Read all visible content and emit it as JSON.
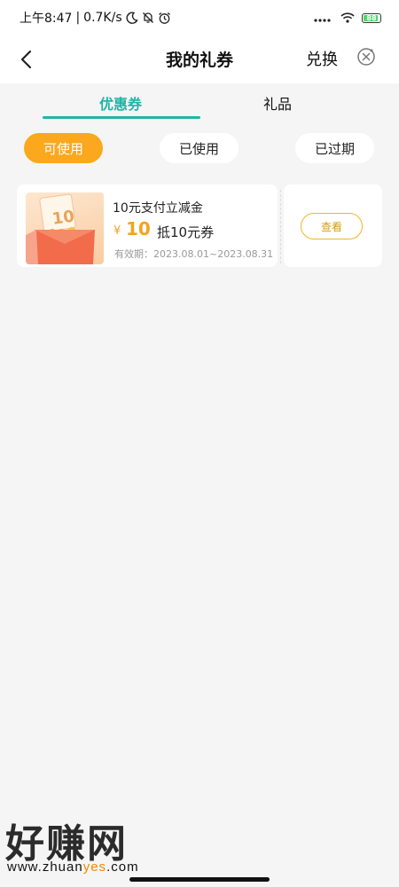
{
  "status_bar": {
    "time": "上午8:47",
    "separator": "|",
    "network_speed": "0.7K/s",
    "battery": "88",
    "icons": [
      "moon-icon",
      "bell-muted-icon",
      "alarm-icon",
      "signal-icon",
      "wifi-icon",
      "battery-icon"
    ]
  },
  "header": {
    "title": "我的礼券",
    "exchange_label": "兑换",
    "icons": [
      "back-arrow-icon",
      "close-circle-icon"
    ]
  },
  "tabs": [
    {
      "label": "优惠券",
      "active": true
    },
    {
      "label": "礼品",
      "active": false
    }
  ],
  "filters": [
    {
      "label": "可使用",
      "active": true
    },
    {
      "label": "已使用",
      "active": false
    },
    {
      "label": "已过期",
      "active": false
    }
  ],
  "coupons": [
    {
      "name": "10元支付立减金",
      "currency": "¥",
      "amount": "10",
      "deduct_label": "抵10元券",
      "validity": "有效期：2023.08.01~2023.08.31",
      "image_text": "10",
      "view_label": "查看"
    }
  ],
  "watermark": {
    "main": "好赚网",
    "url_prefix": "www.zhuan",
    "url_accent": "yes",
    "url_suffix": ".com"
  },
  "colors": {
    "accent_teal": "#1fb5a6",
    "accent_orange": "#fba81e",
    "amount_orange": "#f4a321",
    "background": "#f5f5f5"
  }
}
